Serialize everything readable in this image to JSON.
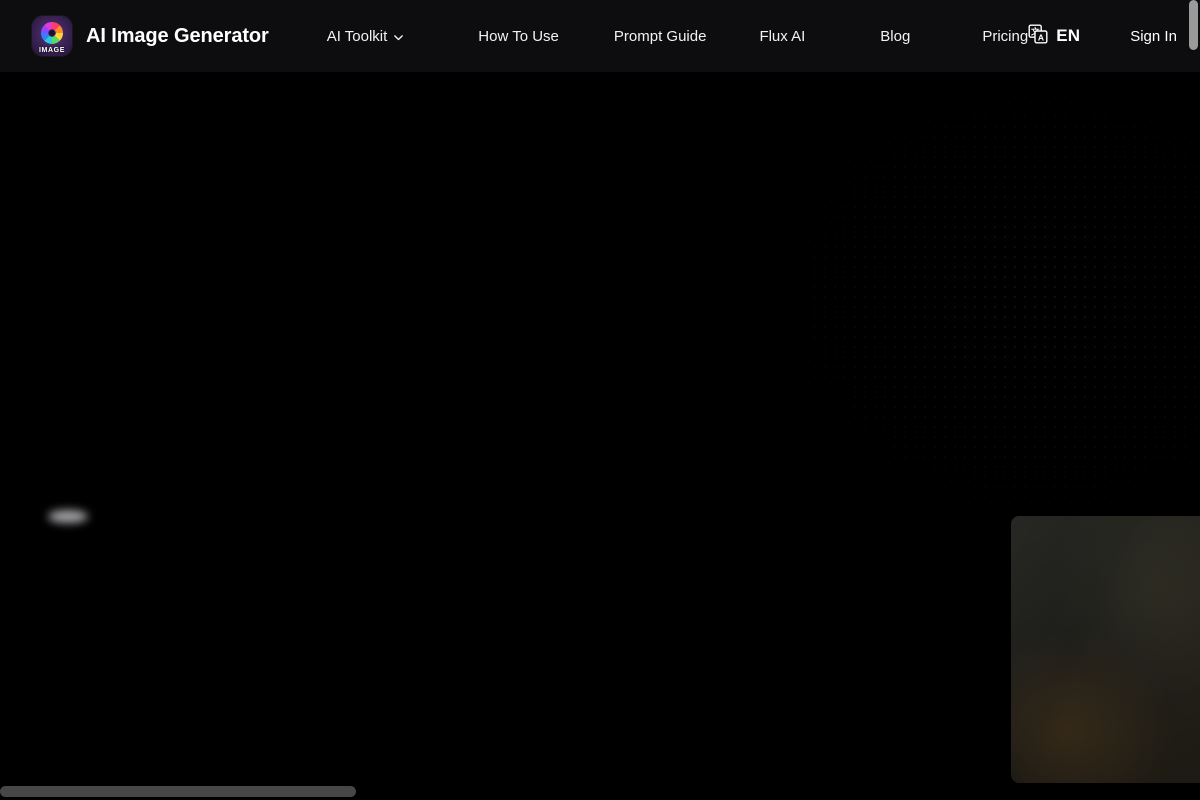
{
  "header": {
    "brand": {
      "title": "AI Image Generator",
      "logo_word": "IMAGE",
      "logo_icon": "rainbow-aperture-icon"
    },
    "nav": [
      {
        "label": "AI Toolkit",
        "has_dropdown": true
      },
      {
        "label": "How To Use",
        "has_dropdown": false
      },
      {
        "label": "Prompt Guide",
        "has_dropdown": false
      },
      {
        "label": "Flux AI",
        "has_dropdown": false
      },
      {
        "label": "Blog",
        "has_dropdown": false
      },
      {
        "label": "Pricing",
        "has_dropdown": false
      }
    ],
    "language": {
      "code": "EN",
      "icon": "translate-icon"
    },
    "sign_in_label": "Sign In"
  },
  "colors": {
    "header_bg": "#0d0d10",
    "page_bg": "#000000",
    "text_primary": "#ffffff",
    "scrollbar_vertical_thumb": "#9a9a9a",
    "scrollbar_horizontal_thumb": "#474747",
    "logo_plate": "#3a2154"
  },
  "content": {
    "dot_pattern": "decorative-dot-grid",
    "glow": "decorative-light-glow",
    "preview_card": "generated-image-preview"
  }
}
